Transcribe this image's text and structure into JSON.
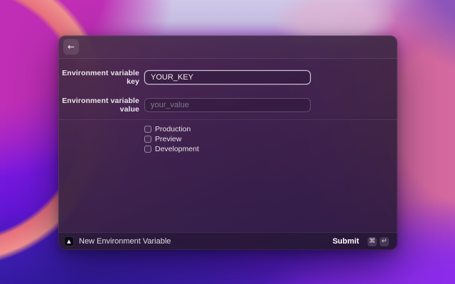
{
  "header": {
    "back_icon": "←"
  },
  "form": {
    "key": {
      "label": "Environment variable key",
      "value": "YOUR_KEY"
    },
    "value": {
      "label": "Environment variable value",
      "placeholder": "your_value"
    },
    "environments": [
      {
        "label": "Production",
        "checked": false
      },
      {
        "label": "Preview",
        "checked": false
      },
      {
        "label": "Development",
        "checked": false
      }
    ]
  },
  "footer": {
    "app_icon": "vercel-triangle-icon",
    "app_icon_glyph": "▲",
    "title": "New Environment Variable",
    "submit_label": "Submit",
    "keys": [
      "⌘",
      "↵"
    ]
  },
  "colors": {
    "focus_border": "#e6def0",
    "window_bg": "#38243e",
    "footer_bg": "#2c1f3c",
    "wallpaper_magenta": "#bf2eb5",
    "wallpaper_coral": "#e8707e",
    "wallpaper_rose": "#d4699f",
    "wallpaper_violet": "#8c2cea",
    "wallpaper_indigo": "#2c1692",
    "wallpaper_lavender": "#cfc8e8"
  }
}
